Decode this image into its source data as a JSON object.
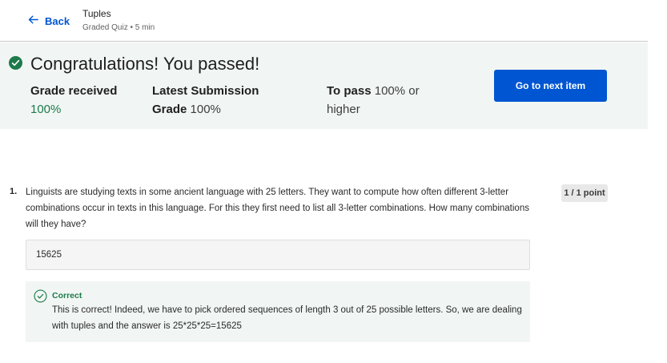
{
  "header": {
    "back_label": "Back",
    "title": "Tuples",
    "subtitle": "Graded Quiz • 5 min"
  },
  "result": {
    "heading": "Congratulations! You passed!",
    "grade_received_label": "Grade received",
    "grade_received_value": "100%",
    "latest_submission_label": "Latest Submission Grade",
    "latest_submission_value": "100%",
    "to_pass_label": "To pass",
    "to_pass_value": "100% or higher",
    "next_button": "Go to next item"
  },
  "question": {
    "number": "1.",
    "text": "Linguists are studying texts in some ancient language with 25 letters. They want to compute how often different 3-letter combinations occur in texts in this language. For this they first need to list all 3-letter combinations. How many combinations will they have?",
    "points": "1 / 1 point",
    "answer": "15625"
  },
  "feedback": {
    "status": "Correct",
    "text": "This is correct! Indeed, we have to pick ordered sequences of length 3 out of 25 possible letters. So, we are dealing with tuples and the answer is 25*25*25=15625"
  },
  "colors": {
    "accent": "#0056d2",
    "success": "#1d7a4a",
    "banner_bg": "#f1f6f4"
  }
}
